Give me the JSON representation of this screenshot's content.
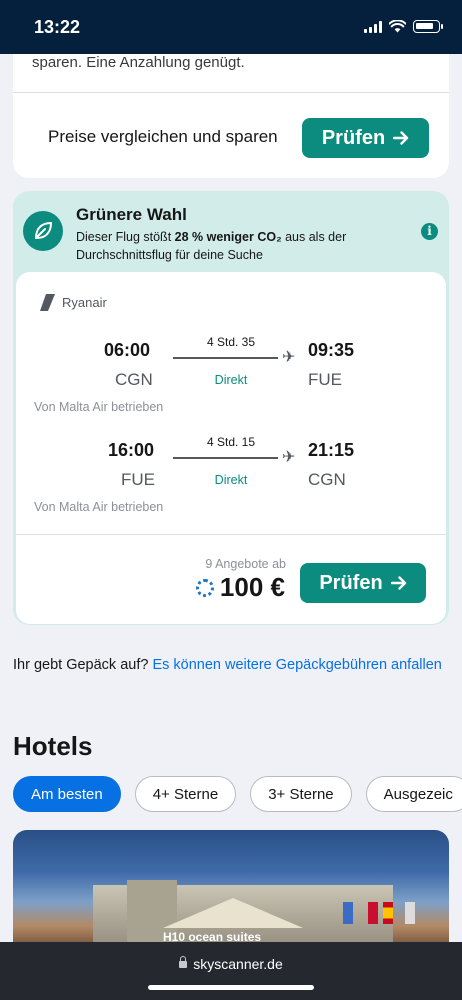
{
  "status_bar": {
    "time": "13:22"
  },
  "top_card": {
    "partial_text": "sparen. Eine Anzahlung genügt.",
    "compare_text": "Preise vergleichen und sparen",
    "button_label": "Prüfen"
  },
  "greener": {
    "title": "Grünere Wahl",
    "text_before": "Dieser Flug stößt ",
    "text_bold": "28 % weniger CO₂",
    "text_after": " aus als der Durchschnittsflug für deine Suche",
    "info_glyph": "i"
  },
  "flight": {
    "airline": "Ryanair",
    "legs": [
      {
        "dep_time": "06:00",
        "dep_airport": "CGN",
        "duration": "4 Std. 35",
        "stops": "Direkt",
        "arr_time": "09:35",
        "arr_airport": "FUE",
        "operator": "Von Malta Air betrieben"
      },
      {
        "dep_time": "16:00",
        "dep_airport": "FUE",
        "duration": "4 Std. 15",
        "stops": "Direkt",
        "arr_time": "21:15",
        "arr_airport": "CGN",
        "operator": "Von Malta Air betrieben"
      }
    ],
    "offers": "9 Angebote ab",
    "price": "100 €",
    "button_label": "Prüfen"
  },
  "baggage": {
    "question": "Ihr gebt Gepäck auf? ",
    "link": "Es können weitere Gepäckgebühren anfallen"
  },
  "hotels": {
    "title": "Hotels",
    "chips": [
      "Am besten",
      "4+ Sterne",
      "3+ Sterne",
      "Ausgezeic"
    ],
    "image_sign": "H10 ocean suites"
  },
  "browser": {
    "url": "skyscanner.de"
  },
  "colors": {
    "primary_green": "#0b8c7e",
    "banner_green": "#d2ede9",
    "link_blue": "#0770e3",
    "navy": "#05203c"
  }
}
